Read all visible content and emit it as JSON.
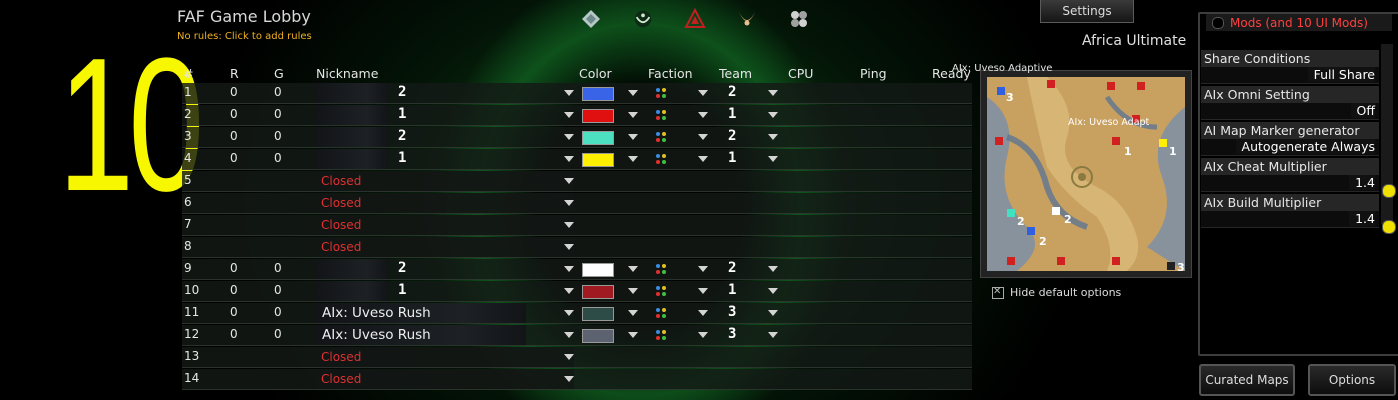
{
  "overlay_number": "10",
  "lobby": {
    "title": "FAF Game Lobby",
    "rules_text": "No rules: Click to add rules",
    "map_name": "Africa Ultimate"
  },
  "faction_icons": [
    "aeon-icon",
    "random-icon",
    "cybran-icon",
    "seraphim-icon",
    "uef-icon"
  ],
  "top_button": {
    "settings_label": "Settings"
  },
  "headers": {
    "num": "#",
    "rating": "R",
    "games": "G",
    "nickname": "Nickname",
    "color": "Color",
    "faction": "Faction",
    "team": "Team",
    "cpu": "CPU",
    "ping": "Ping",
    "ready": "Ready"
  },
  "slots": [
    {
      "num": "1",
      "r": "0",
      "g": "0",
      "state": "player",
      "start": "2",
      "color": "#3a64e8",
      "team": "2"
    },
    {
      "num": "2",
      "r": "0",
      "g": "0",
      "state": "player",
      "start": "1",
      "color": "#e01010",
      "team": "1"
    },
    {
      "num": "3",
      "r": "0",
      "g": "0",
      "state": "player",
      "start": "2",
      "color": "#4de0c0",
      "team": "2"
    },
    {
      "num": "4",
      "r": "0",
      "g": "0",
      "state": "player",
      "start": "1",
      "color": "#ffef00",
      "team": "1"
    },
    {
      "num": "5",
      "state": "closed",
      "label": "Closed"
    },
    {
      "num": "6",
      "state": "closed",
      "label": "Closed"
    },
    {
      "num": "7",
      "state": "closed",
      "label": "Closed"
    },
    {
      "num": "8",
      "state": "closed",
      "label": "Closed"
    },
    {
      "num": "9",
      "r": "0",
      "g": "0",
      "state": "player",
      "start": "2",
      "color": "#ffffff",
      "team": "2"
    },
    {
      "num": "10",
      "r": "0",
      "g": "0",
      "state": "player",
      "start": "1",
      "color": "#a01a22",
      "team": "1"
    },
    {
      "num": "11",
      "r": "0",
      "g": "0",
      "state": "ai",
      "name": "AIx: Uveso Rush",
      "color": "#2d4c48",
      "team": "3"
    },
    {
      "num": "12",
      "r": "0",
      "g": "0",
      "state": "ai",
      "name": "AIx: Uveso Rush",
      "color": "#5c6270",
      "team": "3"
    },
    {
      "num": "13",
      "state": "closed",
      "label": "Closed"
    },
    {
      "num": "14",
      "state": "closed",
      "label": "Closed"
    }
  ],
  "map_preview": {
    "top_label": "AIx: Uveso Adaptive",
    "mid_label": "AIx: Uveso Adapt"
  },
  "hide_default_options": "Hide default options",
  "mods_button": "Mods (and 10 UI Mods)",
  "options": [
    {
      "label": "Share Conditions",
      "value": "Full Share",
      "slider": false
    },
    {
      "label": "AIx Omni Setting",
      "value": "Off",
      "slider": false
    },
    {
      "label": "AI Map Marker generator",
      "value": "Autogenerate Always",
      "slider": false
    },
    {
      "label": "AIx Cheat Multiplier",
      "value": "1.4",
      "slider": true
    },
    {
      "label": "AIx Build Multiplier",
      "value": "1.4",
      "slider": true
    }
  ],
  "bottom_buttons": {
    "curated_maps": "Curated Maps",
    "options": "Options"
  }
}
